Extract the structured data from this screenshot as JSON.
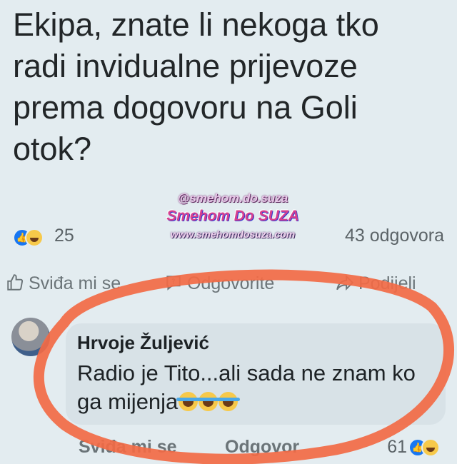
{
  "post": {
    "text": "Ekipa, znate li nekoga tko radi invidualne prijevoze prema dogovoru na Goli otok?",
    "reaction_count": "25",
    "comment_count": "43 odgovora"
  },
  "watermark": {
    "handle": "@smehom.do.suza",
    "title": "Smehom Do SUZA",
    "url": "www.smehomdosuza.com"
  },
  "actions": {
    "like": "Sviđa mi se",
    "reply": "Odgovorite",
    "share": "Podijeli"
  },
  "comment": {
    "author": "Hrvoje Žuljević",
    "text": "Radio je Tito...ali sada ne znam ko ga mijenja",
    "like": "Sviđa mi se",
    "reply": "Odgovor",
    "reaction_count": "61"
  },
  "colors": {
    "background": "#e3ecf0",
    "highlight_circle": "#f26a45",
    "like_blue": "#1877f2"
  },
  "icons": [
    "like-icon",
    "haha-icon",
    "thumbs-up-icon",
    "comment-icon",
    "share-icon",
    "laughing-crying-emoji"
  ]
}
